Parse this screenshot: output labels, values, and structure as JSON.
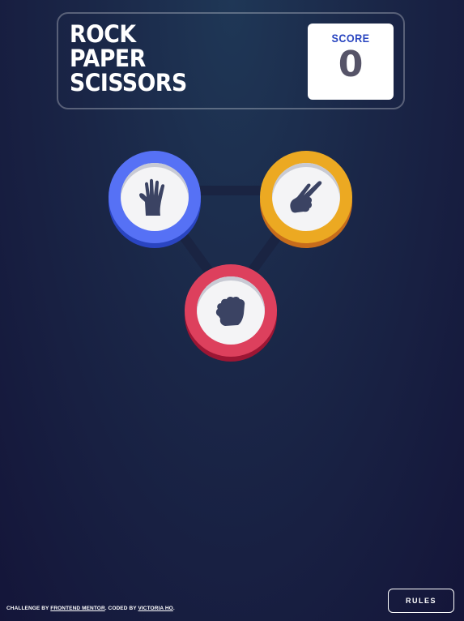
{
  "header": {
    "title_lines": [
      "ROCK",
      "PAPER",
      "SCISSORS"
    ],
    "score_label": "SCORE",
    "score_value": "0"
  },
  "tokens": [
    {
      "name": "paper",
      "icon": "paper-hand-icon",
      "color": "#5671f5",
      "shadow": "#2a45c2"
    },
    {
      "name": "scissors",
      "icon": "scissors-hand-icon",
      "color": "#eca922",
      "shadow": "#c76c1b"
    },
    {
      "name": "rock",
      "icon": "rock-fist-icon",
      "color": "#dd405d",
      "shadow": "#9d1634"
    }
  ],
  "footer": {
    "prefix": "CHALLENGE BY ",
    "link1": "FRONTEND MENTOR",
    "middle": ". CODED BY ",
    "link2": "VICTORIA HO",
    "suffix": ".",
    "rules_label": "RULES"
  }
}
